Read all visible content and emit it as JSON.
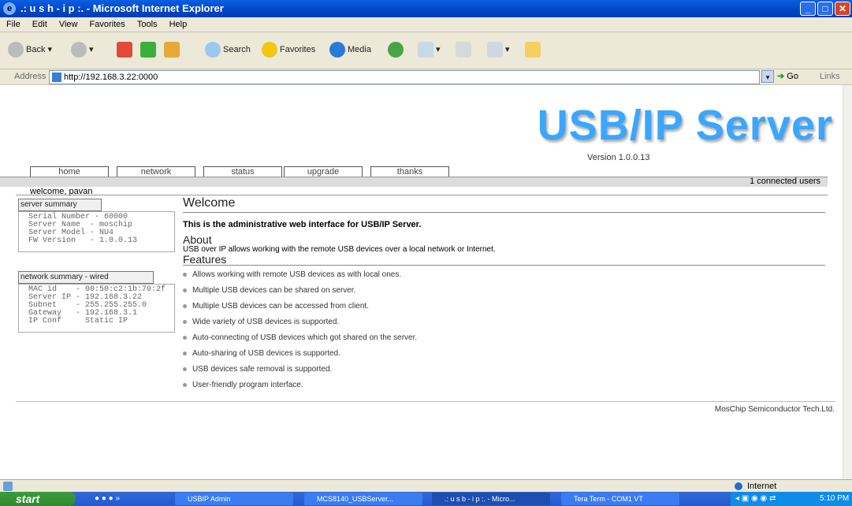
{
  "window": {
    "title": ".: u s h - i p :. - Microsoft Internet Explorer"
  },
  "menu": [
    "File",
    "Edit",
    "View",
    "Favorites",
    "Tools",
    "Help"
  ],
  "toolbar": {
    "back": "Back",
    "search": "Search",
    "favorites": "Favorites",
    "media": "Media"
  },
  "address": {
    "label": "Address",
    "url": "http://192.168.3.22:0000",
    "go": "Go",
    "links": "Links"
  },
  "page": {
    "logo": "USB/IP Server",
    "version": "Version 1.0.0.13",
    "nav": [
      "home",
      "network",
      "status",
      "upgrade",
      "thanks"
    ],
    "connected": "1 connected users",
    "welcome_user": "welcome, pavan",
    "server_summary": {
      "title": "server summary",
      "lines": [
        "Serial Number - 60000",
        "Server Name  - moschip",
        "Server Model - NU4",
        "FW Version   - 1.0.0.13"
      ]
    },
    "network_summary": {
      "title": "network summary - wired",
      "lines": [
        "MAC id    - 00:50:c2:1b:70:2f",
        "Server IP - 192.168.3.22",
        "Subnet    - 255.255.255.0",
        "Gateway   - 192.168.3.1",
        "IP Conf     Static IP"
      ]
    },
    "heading": "Welcome",
    "intro": "This is the administrative web interface for USB/IP Server.",
    "about_heading": "About",
    "about_text": "USB over IP allows working with the remote USB devices over a local network or Internet.",
    "features_heading": "Features",
    "features": [
      "Allows working with remote USB devices as with local ones.",
      "Multiple USB devices can be shared on server.",
      "Multiple USB devices can be accessed from client.",
      "Wide variety of USB devices is supported.",
      "Auto-connecting of USB devices which got shared on the server.",
      "Auto-sharing of USB devices is supported.",
      "USB devices safe removal is supported.",
      "User-friendly program interface."
    ],
    "footer": "MosChip Semiconductor Tech.Ltd."
  },
  "status": {
    "zone": "Internet"
  },
  "taskbar": {
    "start": "start",
    "tasks": [
      "USBIP Admin",
      "MCS8140_USBServer...",
      ".: u s b - i p :. - Micro...",
      "Tera Term - COM1 VT"
    ],
    "clock": "5:10 PM"
  }
}
